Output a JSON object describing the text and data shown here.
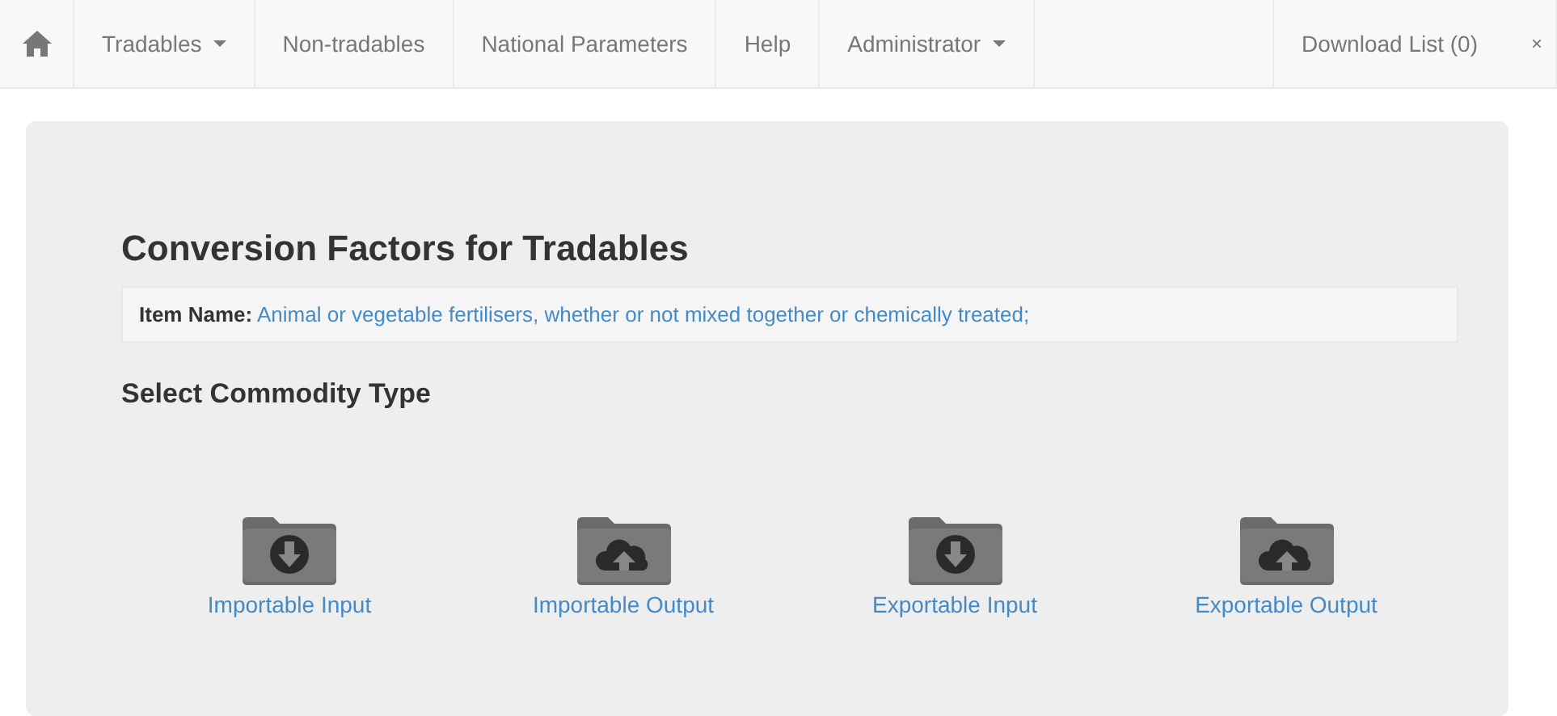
{
  "navbar": {
    "items": [
      {
        "label": "Tradables",
        "dropdown": true
      },
      {
        "label": "Non-tradables",
        "dropdown": false
      },
      {
        "label": "National Parameters",
        "dropdown": false
      },
      {
        "label": "Help",
        "dropdown": false
      },
      {
        "label": "Administrator",
        "dropdown": true
      }
    ],
    "right_items": [
      {
        "label": "Download List (0)"
      },
      {
        "label": "×"
      }
    ]
  },
  "panel": {
    "title": "Conversion Factors for Tradables",
    "item_name_label": "Item Name:",
    "item_name": "Animal or vegetable fertilisers, whether or not mixed together or chemically treated;",
    "subtitle": "Select Commodity Type",
    "options": [
      {
        "label": "Importable Input",
        "kind": "download"
      },
      {
        "label": "Importable Output",
        "kind": "upload"
      },
      {
        "label": "Exportable Input",
        "kind": "download"
      },
      {
        "label": "Exportable Output",
        "kind": "upload"
      }
    ]
  }
}
